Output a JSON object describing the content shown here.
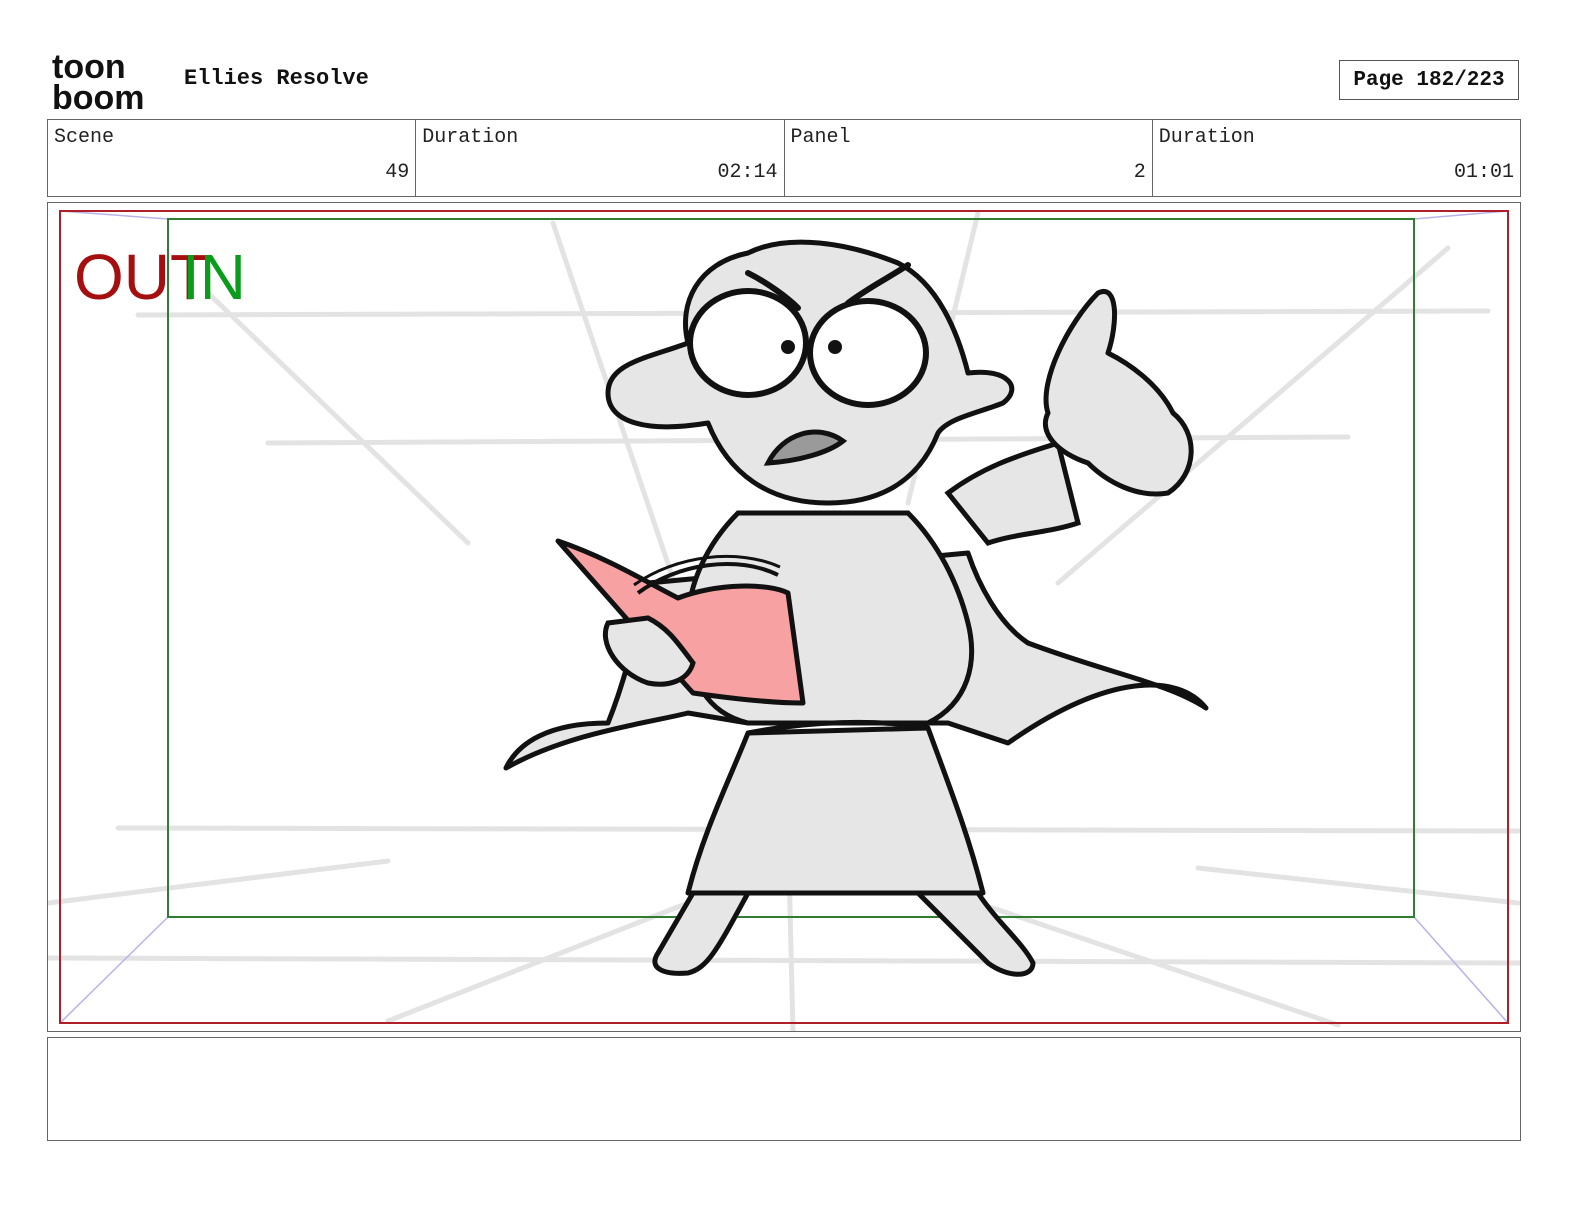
{
  "header": {
    "logo": {
      "line1": "toon",
      "line2": "boom"
    },
    "project_title": "Ellies Resolve",
    "page_label": "Page 182/223"
  },
  "info": {
    "scene_label": "Scene",
    "scene_value": "49",
    "scene_duration_label": "Duration",
    "scene_duration_value": "02:14",
    "panel_label": "Panel",
    "panel_value": "2",
    "panel_duration_label": "Duration",
    "panel_duration_value": "01:01"
  },
  "panel": {
    "marker_out": "OUT",
    "marker_in": "IN",
    "colors": {
      "out_frame": "#b01e2a",
      "in_frame": "#2e7d32",
      "out_text": "#a50f0f",
      "in_text": "#0a9c1a",
      "book": "#f7a1a3",
      "fill": "#e6e6e6",
      "guides": "#b9b2e8"
    }
  },
  "notes": {
    "text": ""
  }
}
